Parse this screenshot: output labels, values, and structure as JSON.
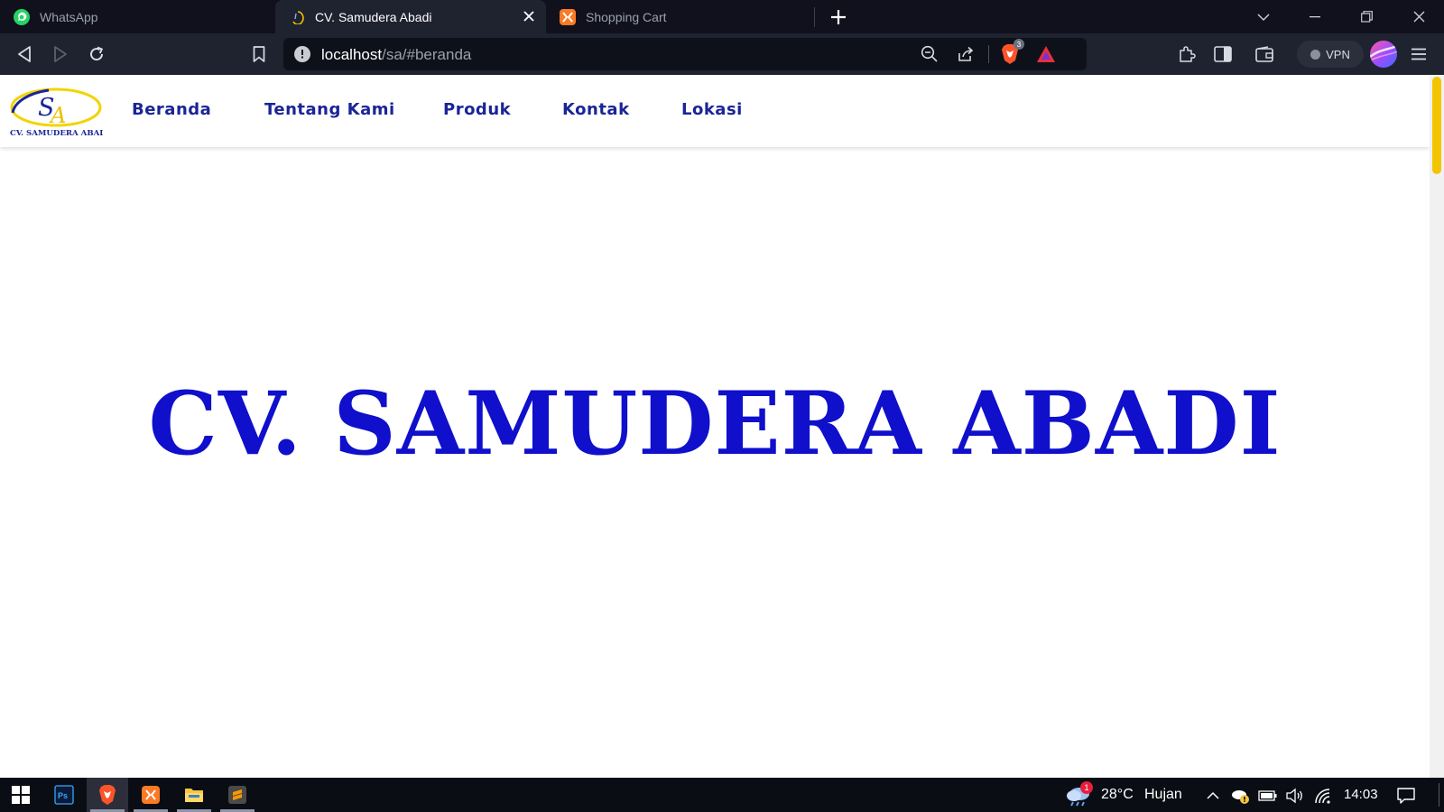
{
  "browser": {
    "tabs": [
      {
        "title": "WhatsApp",
        "icon": "whatsapp-icon",
        "active": false
      },
      {
        "title": "CV. Samudera Abadi",
        "icon": "site-favicon-icon",
        "active": true
      },
      {
        "title": "Shopping Cart",
        "icon": "xampp-icon",
        "active": false
      }
    ],
    "url": {
      "host": "localhost",
      "path": "/sa/#beranda"
    },
    "shields_count": "3",
    "vpn_label": "VPN"
  },
  "site": {
    "logo": {
      "monogram_s": "S",
      "monogram_a": "A",
      "company_text": "CV. SAMUDERA ABADI"
    },
    "nav": [
      "Beranda",
      "Tentang Kami",
      "Produk",
      "Kontak",
      "Lokasi"
    ],
    "hero_title": "CV. SAMUDERA ABADI"
  },
  "colors": {
    "accent_blue": "#0f0fcc",
    "nav_text": "#1a2596",
    "scrollbar_thumb": "#f2c500"
  },
  "taskbar": {
    "apps": [
      "windows-start-icon",
      "photoshop-icon",
      "brave-icon",
      "xampp-icon",
      "file-explorer-icon",
      "sublime-text-icon"
    ],
    "weather": {
      "temperature": "28°C",
      "condition": "Hujan",
      "alert_count": "1"
    },
    "clock": "14:03"
  }
}
